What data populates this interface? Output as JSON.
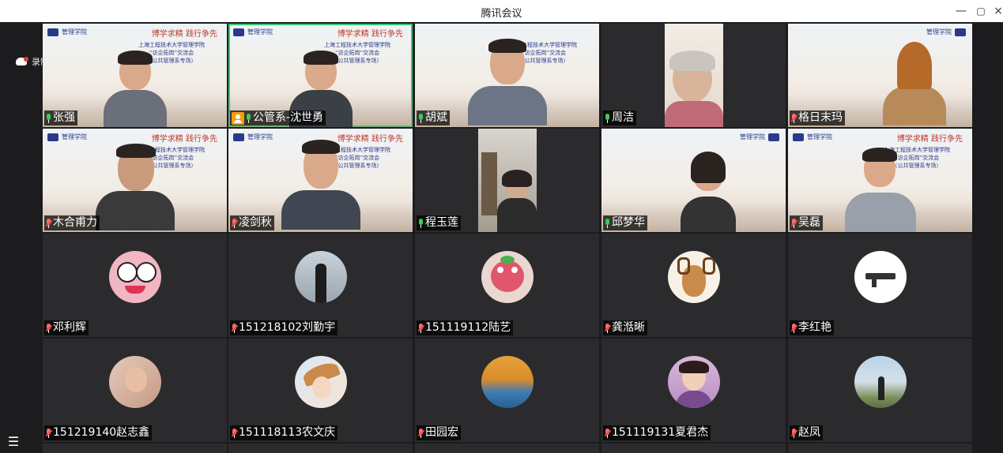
{
  "window": {
    "title": "腾讯会议",
    "minimize": "—",
    "restore": "▢",
    "close": "×"
  },
  "recording": {
    "label": "录制中"
  },
  "menu": {
    "icon": "list-icon",
    "glyph": "☰"
  },
  "colors": {
    "active_border": "#2ecc71",
    "muted_mic": "#ff4444",
    "host_badge": "#f39c12"
  },
  "slide": {
    "school": "管理学院",
    "slogan": "博学求精  践行争先",
    "line1": "上海工程技术大学管理学院",
    "line2": "“访企拓岗”交流会",
    "line3": "（公共管理系专场）"
  },
  "participants": [
    {
      "name": "张强",
      "mic": "on"
    },
    {
      "name": "公管系-沈世勇",
      "mic": "on",
      "host": true
    },
    {
      "name": "胡斌",
      "mic": "on"
    },
    {
      "name": "周洁",
      "mic": "on"
    },
    {
      "name": "格日末玛",
      "mic": "muted"
    },
    {
      "name": "木合甫力",
      "mic": "muted"
    },
    {
      "name": "凌剑秋",
      "mic": "muted"
    },
    {
      "name": "程玉莲",
      "mic": "on"
    },
    {
      "name": "邱梦华",
      "mic": "on"
    },
    {
      "name": "吴磊",
      "mic": "muted"
    },
    {
      "name": "邓利辉",
      "mic": "muted"
    },
    {
      "name": "151218102刘勤宇",
      "mic": "muted"
    },
    {
      "name": "151119112陆艺",
      "mic": "muted"
    },
    {
      "name": "龚湉晰",
      "mic": "muted"
    },
    {
      "name": "李红艳",
      "mic": "muted"
    },
    {
      "name": "151219140赵志鑫",
      "mic": "muted"
    },
    {
      "name": "151118113农文庆",
      "mic": "muted"
    },
    {
      "name": "田园宏",
      "mic": "muted"
    },
    {
      "name": "151119131夏君杰",
      "mic": "muted"
    },
    {
      "name": "赵凤",
      "mic": "muted"
    }
  ]
}
